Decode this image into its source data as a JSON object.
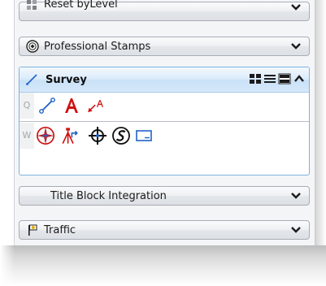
{
  "sections": {
    "reset": {
      "label": "Reset byLevel",
      "icon": "reset-tools-icon"
    },
    "stamps": {
      "label": "Professional Stamps",
      "icon": "stamp-seal-icon"
    },
    "survey": {
      "label": "Survey",
      "icon": "survey-line-icon",
      "view_modes": [
        "large-icon-grid-icon",
        "list-view-icon",
        "detail-view-icon"
      ],
      "collapse_icon": "chevron-up-icon",
      "rows": [
        {
          "key": "Q",
          "tools": [
            "survey-line-tool-icon",
            "text-tool-icon",
            "label-arrow-tool-icon"
          ]
        },
        {
          "key": "W",
          "tools": [
            "compass-rose-icon",
            "tripod-station-icon",
            "crosshair-point-icon",
            "section-symbol-icon",
            "rectangle-frame-icon"
          ]
        }
      ]
    },
    "title_block": {
      "label": "Title Block Integration"
    },
    "traffic": {
      "label": "Traffic",
      "icon": "traffic-sign-icon"
    }
  },
  "colors": {
    "accent_blue": "#1f63c8",
    "tool_red": "#d01010",
    "header_border": "#a7adb5",
    "survey_bg": "#c9e1f7"
  }
}
